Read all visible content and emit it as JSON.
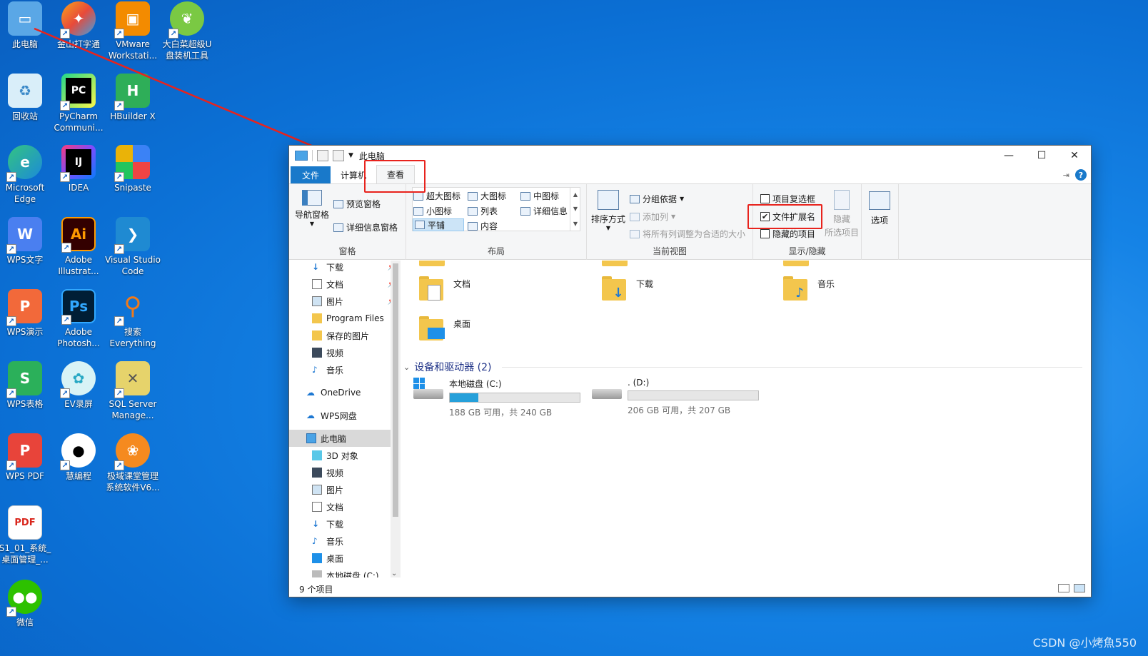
{
  "desktop": {
    "icons": [
      {
        "label": "此电脑"
      },
      {
        "label": "金山打字通"
      },
      {
        "label": "VMware Workstati..."
      },
      {
        "label": "大白菜超级U盘装机工具"
      },
      {
        "label": "回收站"
      },
      {
        "label": "PyCharm Communi..."
      },
      {
        "label": "HBuilder X"
      },
      {
        "label": "Microsoft Edge"
      },
      {
        "label": "IDEA"
      },
      {
        "label": "Snipaste"
      },
      {
        "label": "WPS文字"
      },
      {
        "label": "Adobe Illustrat..."
      },
      {
        "label": "Visual Studio Code"
      },
      {
        "label": "WPS演示"
      },
      {
        "label": "Adobe Photosh..."
      },
      {
        "label": "搜索 Everything"
      },
      {
        "label": "WPS表格"
      },
      {
        "label": "EV录屏"
      },
      {
        "label": "SQL Server Manage..."
      },
      {
        "label": "WPS PDF"
      },
      {
        "label": "慧编程"
      },
      {
        "label": "极域课堂管理系统软件V6..."
      },
      {
        "label": "S1_01_系统_桌面管理_..."
      },
      {
        "label": "微信"
      }
    ],
    "glyphs": {
      "pc": "PC",
      "ij": "IJ",
      "ai": "Ai",
      "ps": "Ps",
      "h": "H",
      "w": "W",
      "p": "P",
      "s": "S",
      "pdf": "PDF"
    }
  },
  "window": {
    "title": "此电脑",
    "controls": {
      "minimize": "—",
      "maximize": "☐",
      "close": "✕"
    },
    "tabs": {
      "file": "文件",
      "computer": "计算机",
      "view": "查看"
    },
    "help": "?",
    "pin": "⇥"
  },
  "ribbon": {
    "pane": {
      "nav_pane": "导航窗格",
      "preview_pane": "预览窗格",
      "details_pane": "详细信息窗格",
      "group": "窗格"
    },
    "layout": {
      "extra_large": "超大图标",
      "large": "大图标",
      "medium": "中图标",
      "small": "小图标",
      "list": "列表",
      "details": "详细信息",
      "tiles": "平铺",
      "content": "内容",
      "group": "布局"
    },
    "current_view": {
      "sort_by": "排序方式",
      "group_by": "分组依据",
      "add_columns": "添加列",
      "size_columns": "将所有列调整为合适的大小",
      "group": "当前视图"
    },
    "show_hide": {
      "item_checkboxes": "项目复选框",
      "file_extensions": "文件扩展名",
      "hidden_items": "隐藏的项目",
      "hide": "隐藏",
      "selected_items": "所选项目",
      "group": "显示/隐藏",
      "file_extensions_checked": true,
      "item_checkboxes_checked": false,
      "hidden_items_checked": false
    },
    "options": "选项"
  },
  "nav": {
    "items": [
      {
        "label": "下载",
        "pinned": true
      },
      {
        "label": "文档",
        "pinned": true
      },
      {
        "label": "图片",
        "pinned": true
      },
      {
        "label": "Program Files"
      },
      {
        "label": "保存的图片"
      },
      {
        "label": "视频"
      },
      {
        "label": "音乐"
      },
      {
        "label": "OneDrive"
      },
      {
        "label": "WPS网盘"
      },
      {
        "label": "此电脑"
      },
      {
        "label": "3D 对象"
      },
      {
        "label": "视频"
      },
      {
        "label": "图片"
      },
      {
        "label": "文档"
      },
      {
        "label": "下载"
      },
      {
        "label": "音乐"
      },
      {
        "label": "桌面"
      },
      {
        "label": "本地磁盘 (C:)"
      }
    ]
  },
  "content": {
    "folders": [
      "文档",
      "下载",
      "音乐",
      "桌面"
    ],
    "section": "设备和驱动器 (2)",
    "drives": [
      {
        "name": "本地磁盘 (C:)",
        "free": "188 GB 可用，共 240 GB",
        "used_fraction": 0.22
      },
      {
        "name": ". (D:)",
        "free": "206 GB 可用，共 207 GB",
        "used_fraction": 0.0
      }
    ]
  },
  "status": {
    "count": "9 个项目"
  },
  "watermark": "CSDN @小烤魚550",
  "colors": {
    "accent": "#1979ca",
    "annotation": "#e8231d",
    "desktop": "#1583e6"
  }
}
